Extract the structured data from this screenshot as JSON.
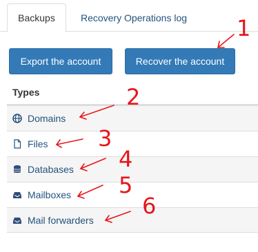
{
  "tabs": [
    {
      "label": "Backups",
      "active": true
    },
    {
      "label": "Recovery Operations log",
      "active": false
    }
  ],
  "buttons": {
    "export_label": "Export the account",
    "recover_label": "Recover the account"
  },
  "types": {
    "header": "Types",
    "items": [
      {
        "label": "Domains",
        "icon": "globe-icon"
      },
      {
        "label": "Files",
        "icon": "file-icon"
      },
      {
        "label": "Databases",
        "icon": "database-icon"
      },
      {
        "label": "Mailboxes",
        "icon": "inbox-icon"
      },
      {
        "label": "Mail forwarders",
        "icon": "inbox-icon"
      }
    ]
  },
  "annotations": [
    "1",
    "2",
    "3",
    "4",
    "5",
    "6"
  ],
  "colors": {
    "button_bg": "#337ab7",
    "link": "#23527c",
    "annotation": "#e8141b",
    "row_stripe": "#f5f5f5"
  }
}
